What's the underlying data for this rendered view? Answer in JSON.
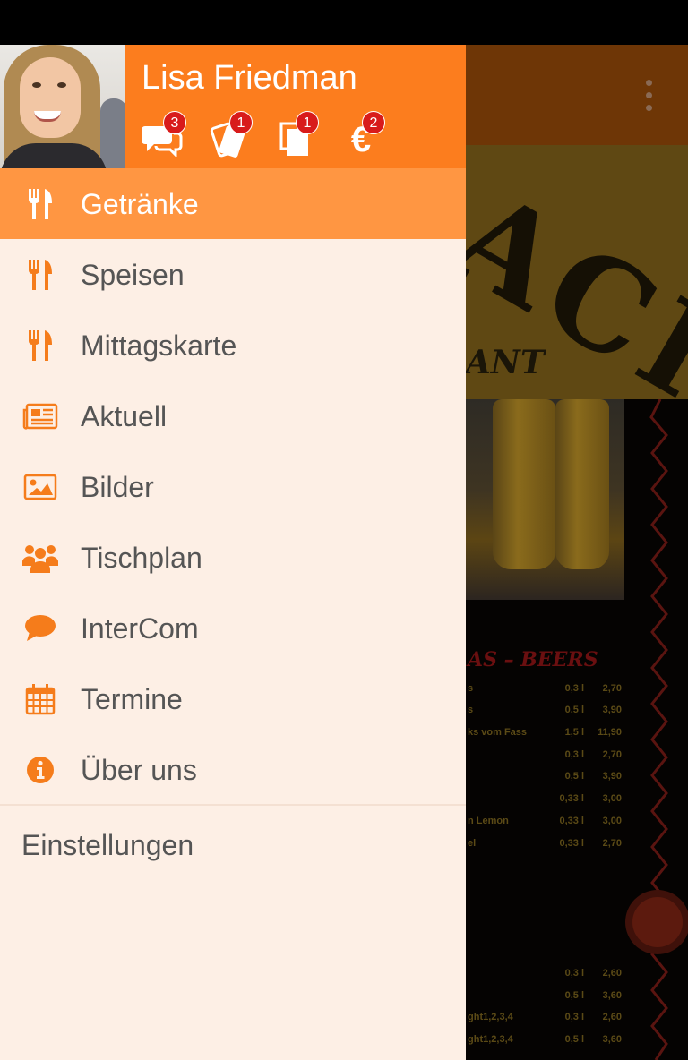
{
  "drawer": {
    "user": {
      "name": "Lisa Friedman"
    },
    "badges": [
      {
        "icon": "chat-bubbles-icon",
        "count": "3"
      },
      {
        "icon": "tickets-icon",
        "count": "1"
      },
      {
        "icon": "documents-icon",
        "count": "1"
      },
      {
        "icon": "euro-icon",
        "count": "2"
      }
    ],
    "menu": [
      {
        "label": "Getränke",
        "icon": "cutlery-icon",
        "active": true
      },
      {
        "label": "Speisen",
        "icon": "cutlery-icon"
      },
      {
        "label": "Mittagskarte",
        "icon": "cutlery-icon"
      },
      {
        "label": "Aktuell",
        "icon": "newspaper-icon"
      },
      {
        "label": "Bilder",
        "icon": "image-icon"
      },
      {
        "label": "Tischplan",
        "icon": "group-icon"
      },
      {
        "label": "InterCom",
        "icon": "speech-bubble-icon"
      },
      {
        "label": "Termine",
        "icon": "calendar-icon"
      },
      {
        "label": "Über uns",
        "icon": "info-icon"
      }
    ],
    "settings_label": "Einstellungen"
  },
  "background": {
    "banner_logo": "ACHI",
    "banner_subtitle": "ANT",
    "section_heading": "AS – BEERS",
    "rows": [
      {
        "name": "s",
        "qty": "0,3 l",
        "price": "2,70"
      },
      {
        "name": "s",
        "qty": "0,5 l",
        "price": "3,90"
      },
      {
        "name": "ks vom Fass",
        "qty": "1,5 l",
        "price": "11,90"
      },
      {
        "name": "",
        "qty": "0,3 l",
        "price": "2,70"
      },
      {
        "name": "",
        "qty": "0,5 l",
        "price": "3,90"
      },
      {
        "name": "",
        "qty": "0,33 l",
        "price": "3,00"
      },
      {
        "name": "n Lemon",
        "qty": "0,33 l",
        "price": "3,00"
      },
      {
        "name": "el",
        "qty": "0,33 l",
        "price": "2,70"
      },
      {
        "name": "",
        "qty": "0,3 l",
        "price": "2,60"
      },
      {
        "name": "",
        "qty": "0,5 l",
        "price": "3,60"
      },
      {
        "name": "ght1,2,3,4",
        "qty": "0,3 l",
        "price": "2,60"
      },
      {
        "name": "ght1,2,3,4",
        "qty": "0,5 l",
        "price": "3,60"
      }
    ]
  },
  "colors": {
    "accent": "#fc7d1e",
    "active_row": "#ff9642",
    "drawer_bg": "#fdefe5",
    "badge": "#d81b1b"
  }
}
